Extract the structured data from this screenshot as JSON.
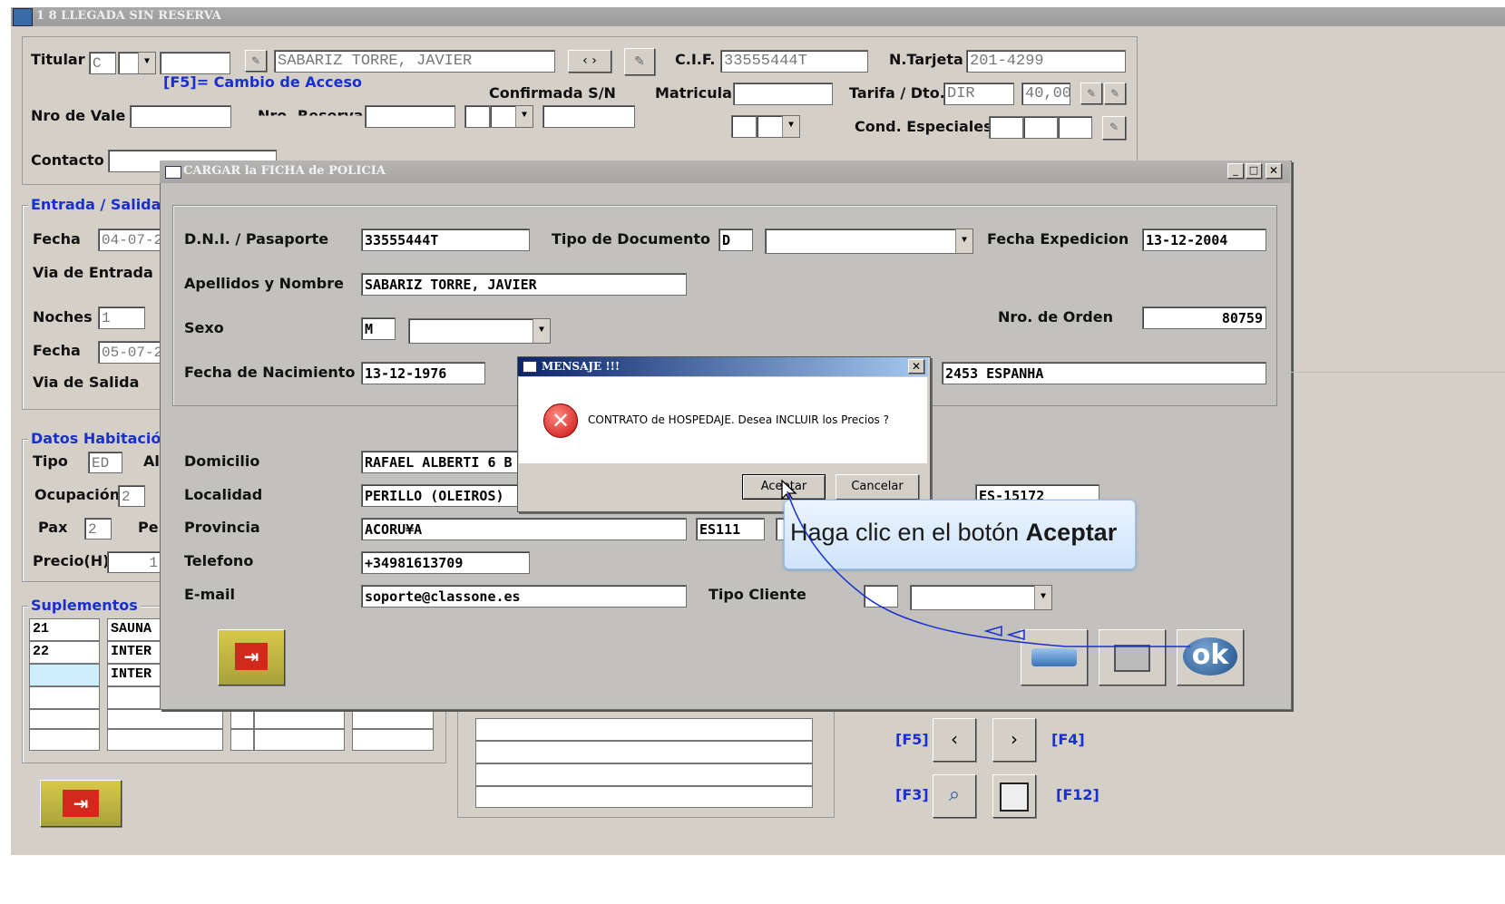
{
  "main_window": {
    "title": "1 8 LLEGADA SIN RESERVA",
    "titular_label": "Titular",
    "titular_code": "C",
    "titular_name": "SABARIZ TORRE, JAVIER",
    "change_access_hint": "[F5]= Cambio de Acceso",
    "cif_label": "C.I.F.",
    "cif_value": "33555444T",
    "ntarjeta_label": "N.Tarjeta",
    "ntarjeta_value": "201-4299",
    "confirmada_label": "Confirmada S/N",
    "matricula_label": "Matricula",
    "tarifa_label": "Tarifa / Dto.",
    "tarifa_value": "DIR",
    "dto_value": "40,00",
    "nro_vale_label": "Nro de Vale",
    "nro_reserva_label": "Nro. Reserva",
    "cond_especiales_label": "Cond. Especiales",
    "contacto_label": "Contacto",
    "entrada_group": "Entrada / Salida",
    "fecha_label": "Fecha",
    "fecha_entrada": "04-07-2",
    "via_entrada_label": "Via de Entrada",
    "noches_label": "Noches",
    "noches_value": "1",
    "fecha2_label": "Fecha",
    "fecha_salida": "05-07-2",
    "via_salida_label": "Via de Salida",
    "datos_group": "Datos Habitación",
    "tipo_label": "Tipo",
    "tipo_value": "ED",
    "al_label": "Al",
    "ocupacion_label": "Ocupación",
    "ocupacion_value": "2",
    "pax_label": "Pax",
    "pax_value": "2",
    "pe_label": "Pe",
    "precio_label": "Precio(H)",
    "precio_value": "1",
    "suplementos_group": "Suplementos",
    "suplementos": [
      {
        "code": "21",
        "name": "SAUNA"
      },
      {
        "code": "22",
        "name": "INTER"
      },
      {
        "code": "",
        "name": "INTER"
      }
    ],
    "nav": {
      "f5": "[F5]",
      "f4": "[F4]",
      "f3": "[F3]",
      "f12": "[F12]",
      "prev": "‹",
      "next": "›"
    }
  },
  "police_dialog": {
    "title": "CARGAR la FICHA de POLICIA",
    "dni_label": "D.N.I. / Pasaporte",
    "dni_value": "33555444T",
    "tipo_doc_label": "Tipo de Documento",
    "tipo_doc_value": "D",
    "fecha_exp_label": "Fecha Expedicion",
    "fecha_exp_value": "13-12-2004",
    "apellidos_label": "Apellidos y Nombre",
    "apellidos_value": "SABARIZ TORRE, JAVIER",
    "sexo_label": "Sexo",
    "sexo_value": "M",
    "nro_orden_label": "Nro. de Orden",
    "nro_orden_value": "80759",
    "fecha_nac_label": "Fecha de Nacimiento",
    "fecha_nac_value": "13-12-1976",
    "pais_value": "2453 ESPANHA",
    "domicilio_label": "Domicilio",
    "domicilio_value": "RAFAEL ALBERTI 6 B",
    "localidad_label": "Localidad",
    "localidad_value": "PERILLO (OLEIROS)",
    "cp_value": "ES-15172",
    "provincia_label": "Provincia",
    "provincia_value": "ACORU¥A",
    "provincia_code": "ES111",
    "telefono_label": "Telefono",
    "telefono_value": "+34981613709",
    "email_label": "E-mail",
    "email_value": "soporte@classone.es",
    "tipo_cliente_label": "Tipo Cliente",
    "ok_label": "ok"
  },
  "message_box": {
    "title": "MENSAJE !!!",
    "text": "CONTRATO de HOSPEDAJE. Desea INCLUIR los Precios ?",
    "accept": "Aceptar",
    "cancel": "Cancelar"
  },
  "tooltip": {
    "prefix": "Haga clic en el botón ",
    "bold": "Aceptar"
  }
}
